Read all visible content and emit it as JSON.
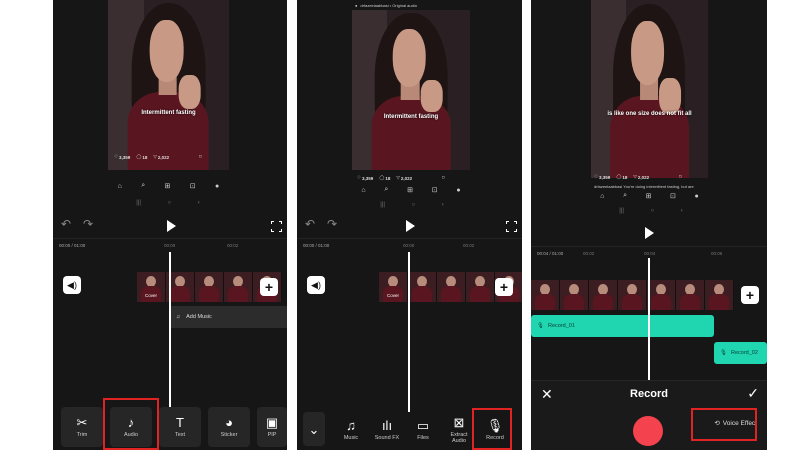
{
  "preview": {
    "caption_1": "Intermittent fasting",
    "caption_2": "Intermittent fasting",
    "caption_3": "is like one size does not fit all",
    "likes": "3,359",
    "comments": "18",
    "shares": "2,022",
    "top_label": "drfazeelaabbasi • Original audio",
    "post_desc": "drfazeelaabbasi You're doing intermittent fasting, but are"
  },
  "panel1": {
    "time_current": "00:00",
    "time_total": "01:00",
    "tick_a": "00:00",
    "tick_b": "00:02",
    "cover_label": "Cover",
    "add_music_label": "Add Music",
    "tools": [
      {
        "label": "Trim",
        "icon": "scissors-icon"
      },
      {
        "label": "Audio",
        "icon": "music-note-icon"
      },
      {
        "label": "Text",
        "icon": "text-icon"
      },
      {
        "label": "Sticker",
        "icon": "sticker-icon"
      },
      {
        "label": "PIP",
        "icon": "image-icon"
      }
    ]
  },
  "panel2": {
    "time_current": "00:00",
    "time_total": "01:00",
    "tick_a": "00:00",
    "tick_b": "00:02",
    "cover_label": "Cover",
    "tools": [
      {
        "label": "Music",
        "icon": "music-note-icon"
      },
      {
        "label": "Sound FX",
        "icon": "sound-fx-icon"
      },
      {
        "label": "Files",
        "icon": "folder-icon"
      },
      {
        "label": "Extract\nAudio",
        "icon": "extract-audio-icon"
      },
      {
        "label": "Record",
        "icon": "microphone-icon"
      }
    ]
  },
  "panel3": {
    "time_current": "00:04",
    "time_total": "01:00",
    "tick_a": "00:02",
    "tick_b": "00:04",
    "tick_c": "00:06",
    "record_1": "Record_01",
    "record_2": "Record_02",
    "footer_title": "Record",
    "voice_effect": "Voice Effect"
  },
  "colors": {
    "accent_record": "#1fd6b1",
    "record_button": "#f4424f",
    "highlight": "#e02424"
  }
}
